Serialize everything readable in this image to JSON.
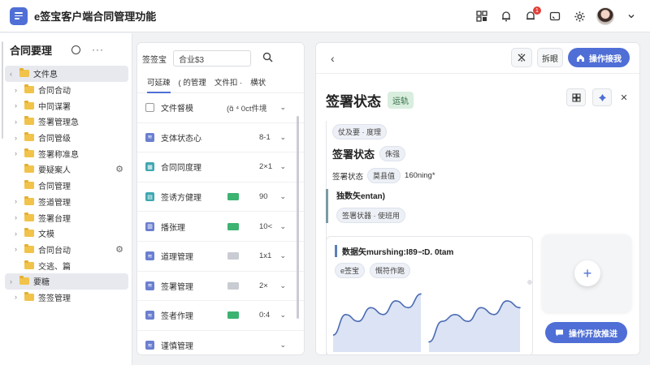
{
  "app": {
    "title": "e签宝客户端合同管理功能"
  },
  "header": {
    "notification_count": "1"
  },
  "sidebar": {
    "title": "合同要理",
    "more": "···",
    "items": [
      {
        "label": "文件息",
        "expanded": true,
        "selected": true,
        "gear": false,
        "chevron": true
      },
      {
        "label": "合同合动",
        "gear": false,
        "chevron": true
      },
      {
        "label": "中同谋署",
        "gear": false,
        "chevron": true
      },
      {
        "label": "签署管理急",
        "gear": false,
        "chevron": true
      },
      {
        "label": "合同管级",
        "gear": false,
        "chevron": true
      },
      {
        "label": "签署称准息",
        "gear": false,
        "chevron": true
      },
      {
        "label": "要疑案人",
        "gear": true,
        "chevron": false
      },
      {
        "label": "合同管理",
        "gear": false,
        "chevron": false
      },
      {
        "label": "签道管理",
        "gear": false,
        "chevron": true
      },
      {
        "label": "签署台理",
        "gear": false,
        "chevron": true
      },
      {
        "label": "文模",
        "gear": false,
        "chevron": true
      },
      {
        "label": "合同台动",
        "gear": true,
        "chevron": true
      },
      {
        "label": "交逃、篇",
        "gear": false,
        "chevron": false
      },
      {
        "label": "要糖",
        "gear": false,
        "chevron": true,
        "selected": true
      },
      {
        "label": "签签管理",
        "gear": false,
        "chevron": true
      }
    ]
  },
  "list": {
    "search_label": "签签宝",
    "search_value": "合业$3",
    "tabs": [
      "可延疎",
      "( 的管理",
      "文件扣 ·",
      "横状"
    ],
    "rows": [
      {
        "label": "文件督模",
        "icon_color": "outline",
        "icon_char": "",
        "value": "(ɑ̃ ⁴ 0ct件境",
        "tag_color": ""
      },
      {
        "label": "支体状态心",
        "icon_color": "#6b7fd0",
        "icon_char": "≋",
        "value": "8-1",
        "tag_color": ""
      },
      {
        "label": "合同同度理",
        "icon_color": "#3fa7b0",
        "icon_char": "▦",
        "value": "2×1",
        "tag_color": ""
      },
      {
        "label": "签诱方健理",
        "icon_color": "#3fa7b0",
        "icon_char": "▤",
        "value": "90",
        "tag_color": "#3cb371"
      },
      {
        "label": "播张理",
        "icon_color": "#6b7fd0",
        "icon_char": "▥",
        "value": "10<",
        "tag_color": "#3cb371"
      },
      {
        "label": "道理管理",
        "icon_color": "#6b7fd0",
        "icon_char": "≋",
        "value": "1x1",
        "tag_color": "#c9ccd2"
      },
      {
        "label": "签署管理",
        "icon_color": "#6b7fd0",
        "icon_char": "≋",
        "value": "2×",
        "tag_color": "#c9ccd2"
      },
      {
        "label": "签者作理",
        "icon_color": "#6b7fd0",
        "icon_char": "≋",
        "value": "0:4",
        "tag_color": "#3cb371"
      },
      {
        "label": "谨慎管理",
        "icon_color": "#6b7fd0",
        "icon_char": "≋",
        "value": "",
        "tag_color": ""
      }
    ]
  },
  "detail": {
    "filter_btn": "拆眼",
    "primary_btn": "操作接我",
    "title": "签署状态",
    "status": "运轨",
    "section1": {
      "chip": "仗及要 · 度理",
      "heading": "签署状态",
      "heading_chip": "侏强",
      "sub_label": "签署状态",
      "sub_chip": "莫县值",
      "sub_value": "160ning*"
    },
    "section2": {
      "heading": "独数矢entan)",
      "chip": "签署状器 · 使班用"
    },
    "card": {
      "title": "数据矢murshing:I89∹D. 0tam",
      "chip1": "e签宝",
      "chip2": "慨符作跑"
    },
    "fab_label": "操作开放推进"
  },
  "colors": {
    "accent": "#4f6fd6",
    "status_green": "#d9eede",
    "folder": "#f1c34a"
  },
  "chart_data": {
    "type": "area",
    "series": [
      {
        "values": [
          2,
          5,
          4,
          6,
          5,
          7,
          6,
          8
        ]
      },
      {
        "values": [
          1,
          4,
          5,
          4,
          6,
          5,
          7,
          6
        ]
      }
    ]
  }
}
